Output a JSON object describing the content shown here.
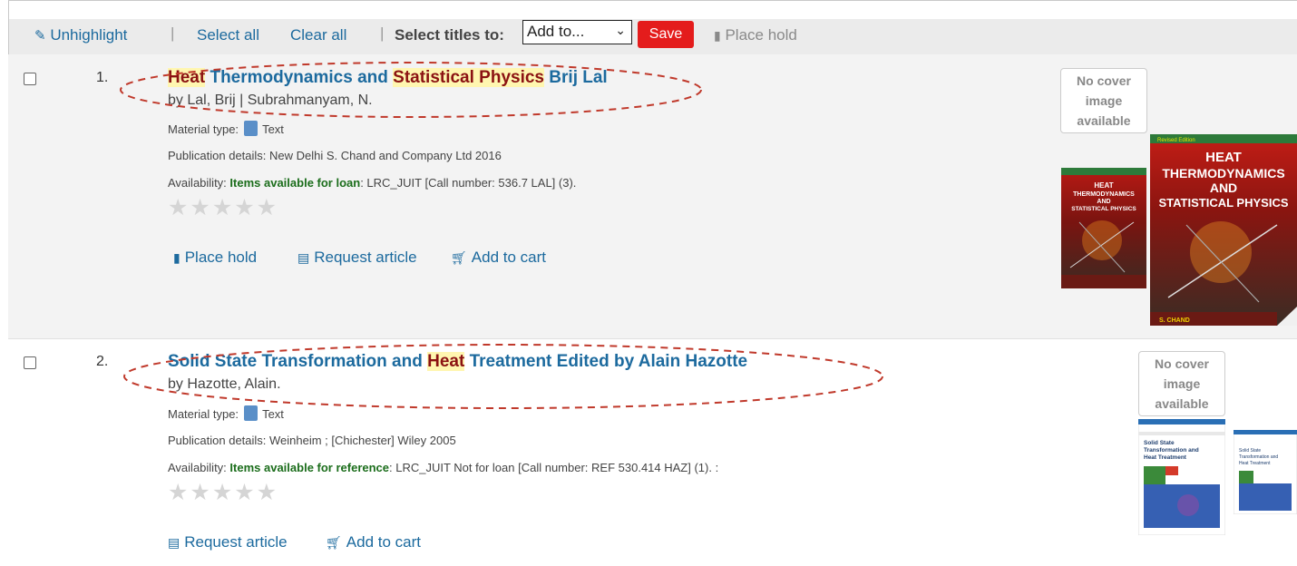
{
  "toolbar": {
    "unhighlight": "Unhighlight",
    "select_all": "Select all",
    "clear_all": "Clear all",
    "select_titles_label": "Select titles to:",
    "select_value": "Add to...",
    "save": "Save",
    "place_hold": "Place hold",
    "separator": "|"
  },
  "results": [
    {
      "number": "1.",
      "title_parts": [
        "Heat",
        " Thermodynamics and ",
        "Statistical Physics",
        " Brij Lal"
      ],
      "author": "by Lal, Brij | Subrahmanyam, N.",
      "material_label": "Material type:",
      "material_value": "Text",
      "publication": "Publication details: New Delhi S. Chand and Company Ltd 2016",
      "availability_label": "Availability:",
      "availability_bold": "Items available for loan",
      "availability_rest": ": LRC_JUIT [Call number: 536.7 LAL] (3).",
      "stars": "★★★★★",
      "actions": [
        "Place hold",
        "Request article",
        "Add to cart"
      ],
      "no_cover": [
        "No cover",
        "image",
        "available"
      ],
      "cover_title_lines": [
        "HEAT",
        "THERMODYNAMICS",
        "AND",
        "STATISTICAL PHYSICS"
      ],
      "cover_small_lines": [
        "HEAT",
        "THERMODYNAMICS",
        "AND",
        "STATISTICAL PHYSICS"
      ],
      "cover_publisher": "S. CHAND",
      "cover_edition": "Revised Edition"
    },
    {
      "number": "2.",
      "title_parts": [
        "Solid State Transformation and ",
        "Heat",
        " Treatment Edited by Alain Hazotte"
      ],
      "author": "by Hazotte, Alain.",
      "material_label": "Material type:",
      "material_value": "Text",
      "publication": "Publication details: Weinheim ; [Chichester] Wiley 2005",
      "availability_label": "Availability:",
      "availability_bold": "Items available for reference",
      "availability_rest": ": LRC_JUIT Not for loan [Call number: REF 530.414 HAZ] (1). :",
      "stars": "★★★★★",
      "actions": [
        "Request article",
        "Add to cart"
      ],
      "no_cover": [
        "No cover",
        "image",
        "available"
      ],
      "cover_title_lines": [
        "Solid State",
        "Transformation and",
        "Heat Treatment"
      ]
    }
  ],
  "colors": {
    "link": "#1c6a9e",
    "highlight_bg": "#fff6b0",
    "highlight_text": "#8b1212",
    "save_red": "#e41c1c",
    "available_green": "#1b6d1b",
    "annotation_red": "#c0392b"
  }
}
